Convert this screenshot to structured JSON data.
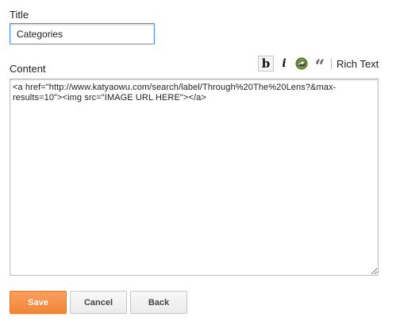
{
  "form": {
    "title_label": "Title",
    "title_value": "Categories",
    "content_label": "Content",
    "content_value": "<a href=\"http://www.katyaowu.com/search/label/Through%20The%20Lens?&max-results=10\"><img src=\"IMAGE URL HERE\"></a>"
  },
  "toolbar": {
    "bold_label": "b",
    "italic_label": "i",
    "quote_label": "“",
    "rich_text_label": "Rich Text"
  },
  "buttons": {
    "save_label": "Save",
    "cancel_label": "Cancel",
    "back_label": "Back"
  },
  "colors": {
    "save_button": "#f48b3f",
    "title_input_border": "#4d90fe"
  },
  "icons": {
    "bold": "bold-icon",
    "italic": "italic-icon",
    "insert_image": "insert-image-icon",
    "quote": "quote-icon"
  }
}
